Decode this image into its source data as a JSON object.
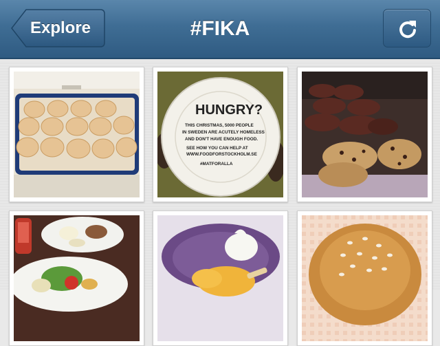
{
  "navbar": {
    "back_label": "Explore",
    "title": "#FIKA"
  },
  "photos": [
    {
      "subject": "buns on baking tray"
    },
    {
      "subject": "paper plate hungry message",
      "plate_text": {
        "headline": "HUNGRY?",
        "lines": [
          "THIS CHRISTMAS, 5000 PEOPLE",
          "IN SWEDEN ARE ACUTELY HOMELESS",
          "AND DON'T HAVE ENOUGH FOOD.",
          "SEE HOW YOU CAN HELP AT",
          "WWW.FOODFORSTOCKHOLM.SE"
        ],
        "tag": "#MATFORALLA"
      }
    },
    {
      "subject": "cookies display"
    },
    {
      "subject": "dinner plates"
    },
    {
      "subject": "ice cream bowl"
    },
    {
      "subject": "pastry bun"
    }
  ],
  "colors": {
    "navbar": "#3f6d94",
    "accent": "#2f5b82"
  }
}
